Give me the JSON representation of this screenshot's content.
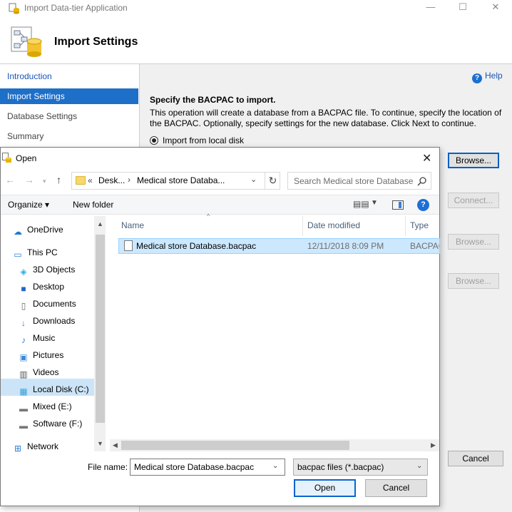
{
  "wizard": {
    "window_title": "Import Data-tier Application",
    "header_title": "Import Settings",
    "nav": [
      {
        "label": "Introduction",
        "state": "link"
      },
      {
        "label": "Import Settings",
        "state": "selected"
      },
      {
        "label": "Database Settings",
        "state": "normal"
      },
      {
        "label": "Summary",
        "state": "normal"
      }
    ],
    "help_label": "Help",
    "heading": "Specify the BACPAC to import.",
    "description": "This operation will create a database from a BACPAC file. To continue, specify the location of the BACPAC.  Optionally, specify settings for the new database. Click Next to continue.",
    "radio_label": "Import from local disk",
    "browse_label": "Browse...",
    "connect_label": "Connect...",
    "browse2_label": "Browse...",
    "browse3_label": "Browse...",
    "cancel_label": "Cancel"
  },
  "dialog": {
    "title": "Open",
    "breadcrumb_overflow": "«",
    "breadcrumb": [
      "Desk...",
      "Medical store Databa..."
    ],
    "search_placeholder": "Search Medical store Database",
    "organize_label": "Organize ▾",
    "new_folder_label": "New folder",
    "tree": [
      {
        "label": "OneDrive",
        "icon": "cloud-icon"
      },
      {
        "label": "This PC",
        "icon": "pc-icon"
      },
      {
        "label": "3D Objects",
        "icon": "cube-icon"
      },
      {
        "label": "Desktop",
        "icon": "desktop-icon"
      },
      {
        "label": "Documents",
        "icon": "document-icon"
      },
      {
        "label": "Downloads",
        "icon": "download-icon"
      },
      {
        "label": "Music",
        "icon": "music-icon"
      },
      {
        "label": "Pictures",
        "icon": "pictures-icon"
      },
      {
        "label": "Videos",
        "icon": "video-icon"
      },
      {
        "label": "Local Disk (C:)",
        "icon": "disk-icon"
      },
      {
        "label": "Mixed (E:)",
        "icon": "drive-icon"
      },
      {
        "label": "Software (F:)",
        "icon": "drive-icon"
      },
      {
        "label": "Network",
        "icon": "network-icon"
      }
    ],
    "columns": {
      "name": "Name",
      "date": "Date modified",
      "type": "Type"
    },
    "files": [
      {
        "name": "Medical store Database.bacpac",
        "date": "12/11/2018 8:09 PM",
        "type": "BACPAC"
      }
    ],
    "file_name_label": "File name:",
    "file_name_value": "Medical store Database.bacpac",
    "file_type_value": "bacpac files (*.bacpac)",
    "open_label": "Open",
    "cancel_label": "Cancel"
  },
  "colors": {
    "accent": "#1e6fc8",
    "selection": "#cce8ff"
  }
}
